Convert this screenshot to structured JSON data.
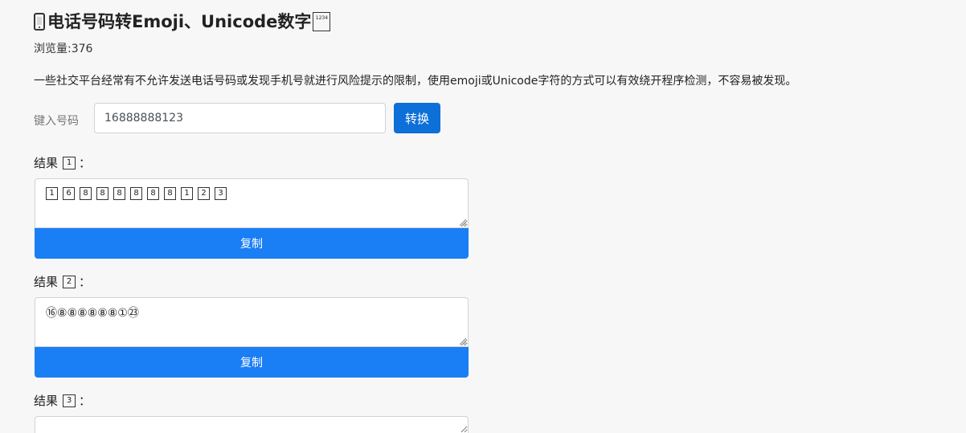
{
  "header": {
    "title_prefix_icon": "mobile-phone-icon",
    "title": "电话号码转Emoji、Unicode数字",
    "title_suffix_icon": "input-numbers-icon",
    "title_suffix_digits": "1234",
    "views": "浏览量:376",
    "description": "一些社交平台经常有不允许发送电话号码或发现手机号就进行风险提示的限制，使用emoji或Unicode字符的方式可以有效绕开程序检测，不容易被发现。"
  },
  "form": {
    "input_label": "键入号码",
    "input_value": "16888888123",
    "convert_button": "转换"
  },
  "results": [
    {
      "label": "结果",
      "keycap": "1",
      "colon": "：",
      "keycaps": [
        "1",
        "6",
        "8",
        "8",
        "8",
        "8",
        "8",
        "8",
        "1",
        "2",
        "3"
      ],
      "copy_button": "复制"
    },
    {
      "label": "结果",
      "keycap": "2",
      "colon": "：",
      "text": "⑯⑧⑧⑧⑧⑧⑧①㉓",
      "copy_button": "复制"
    },
    {
      "label": "结果",
      "keycap": "3",
      "colon": "："
    }
  ],
  "colors": {
    "accent": "#1a7ef5",
    "convert_button": "#0d6fd8",
    "background": "#f7f7f7"
  }
}
